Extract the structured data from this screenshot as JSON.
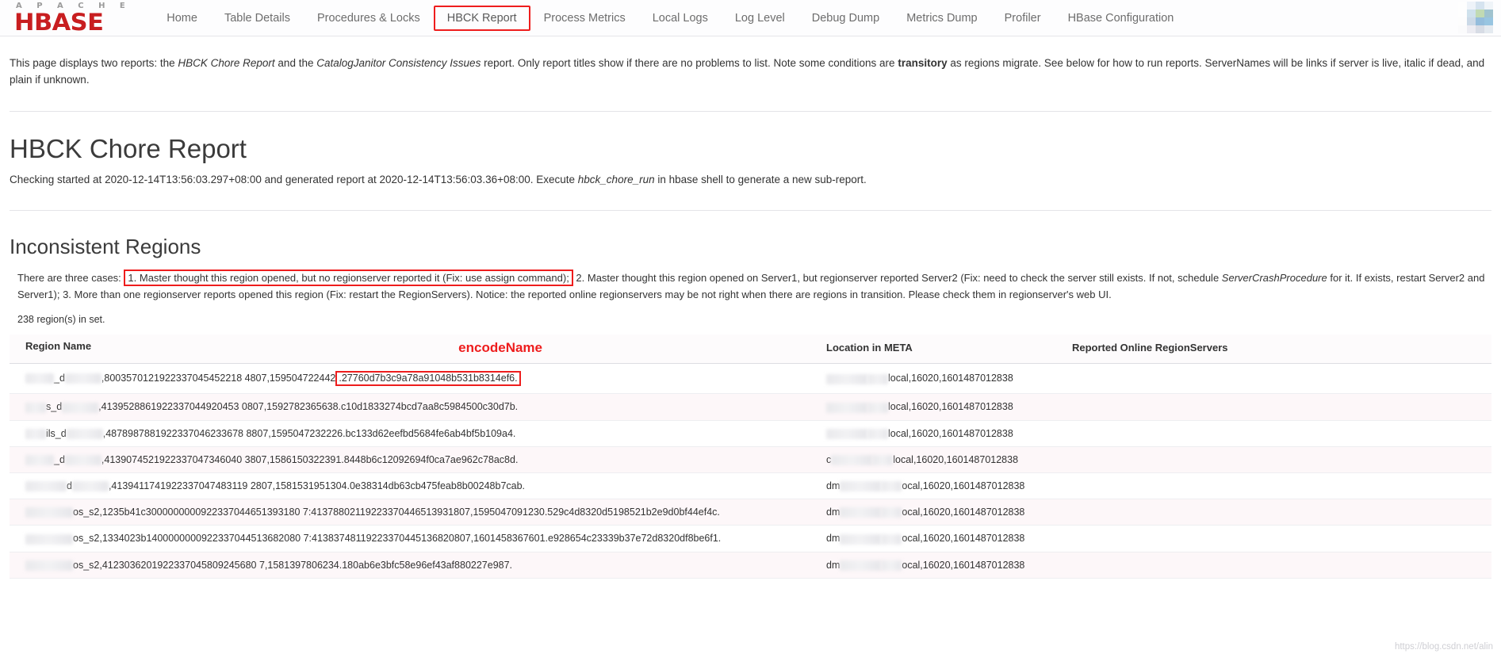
{
  "nav": {
    "brand_top": "A P A C H E",
    "brand_main": "HBASE",
    "items": [
      {
        "label": "Home",
        "name": "nav-home",
        "highlighted": false
      },
      {
        "label": "Table Details",
        "name": "nav-table-details",
        "highlighted": false
      },
      {
        "label": "Procedures & Locks",
        "name": "nav-procedures-locks",
        "highlighted": false
      },
      {
        "label": "HBCK Report",
        "name": "nav-hbck-report",
        "highlighted": true
      },
      {
        "label": "Process Metrics",
        "name": "nav-process-metrics",
        "highlighted": false
      },
      {
        "label": "Local Logs",
        "name": "nav-local-logs",
        "highlighted": false
      },
      {
        "label": "Log Level",
        "name": "nav-log-level",
        "highlighted": false
      },
      {
        "label": "Debug Dump",
        "name": "nav-debug-dump",
        "highlighted": false
      },
      {
        "label": "Metrics Dump",
        "name": "nav-metrics-dump",
        "highlighted": false
      },
      {
        "label": "Profiler",
        "name": "nav-profiler",
        "highlighted": false
      },
      {
        "label": "HBase Configuration",
        "name": "nav-hbase-configuration",
        "highlighted": false
      }
    ]
  },
  "intro": {
    "p1": "This page displays two reports: the ",
    "em1": "HBCK Chore Report",
    "p2": " and the ",
    "em2": "CatalogJanitor Consistency Issues",
    "p3": " report. Only report titles show if there are no problems to list. Note some conditions are ",
    "strong1": "transitory",
    "p4": " as regions migrate. See below for how to run reports. ServerNames will be links if server is live, italic if dead, and plain if unknown."
  },
  "report": {
    "title": "HBCK Chore Report",
    "sub_p1": "Checking started at 2020-12-14T13:56:03.297+08:00 and generated report at 2020-12-14T13:56:03.36+08:00. Execute ",
    "sub_em": "hbck_chore_run",
    "sub_p2": " in hbase shell to generate a new sub-report."
  },
  "inconsistent": {
    "title": "Inconsistent Regions",
    "cases_p1": "There are three cases: ",
    "cases_boxed": "1. Master thought this region opened, but no regionserver reported it (Fix: use assign command);",
    "cases_p2": " 2. Master thought this region opened on Server1, but regionserver reported Server2 (Fix: need to check the server still exists. If not, schedule ",
    "cases_em1": "ServerCrashProcedure",
    "cases_p3": " for it. If exists, restart Server2 and Server1); 3. More than one regionserver reports opened this region (Fix: restart the RegionServers). Notice: the reported online regionservers may be not right when there are regions in transition. Please check them in regionserver's web UI.",
    "count": "238 region(s) in set."
  },
  "table": {
    "headers": {
      "region_name": "Region Name",
      "encode_name": "encodeName",
      "location_meta": "Location in META",
      "reported_rs": "Reported Online RegionServers"
    },
    "rows": [
      {
        "prefix_redacted": true,
        "mid_text": "_d",
        "region_main": ",800357012192233704545221848 07,1595047224421",
        "region_text": ",8003570121922337045452218 4807,159504722442",
        "region_plain": ",8003570121922337045452218 4807,159504722442",
        "region_value": ",8003570121922337045452218 4807,159504722442",
        "encode_boxed": ".27760d7b3c9a78a91048b531b8314ef6.",
        "meta_suffix": "local,16020,1601487012838",
        "meta_prefix": "",
        "reported": ""
      },
      {
        "mid_text": "s_d",
        "region_value": ",4139528861922337044920453 0807,1592782365638.c10d1833274bcd7aa8c5984500c30d7b.",
        "encode_boxed": "",
        "meta_suffix": "local,16020,1601487012838",
        "meta_prefix": "",
        "reported": ""
      },
      {
        "mid_text": "ils_d",
        "region_value": ",4878987881922337046233678 8807,1595047232226.bc133d62eefbd5684fe6ab4bf5b109a4.",
        "encode_boxed": "",
        "meta_suffix": "local,16020,1601487012838",
        "meta_prefix": "",
        "reported": ""
      },
      {
        "mid_text": "_d",
        "region_value": ",4139074521922337047346040 3807,1586150322391.8448b6c12092694f0ca7ae962c78ac8d.",
        "encode_boxed": "",
        "meta_suffix": "local,16020,1601487012838",
        "meta_prefix": "c",
        "reported": ""
      },
      {
        "mid_text": "d",
        "region_value": ",4139411741922337047483119 2807,1581531951304.0e38314db63cb475feab8b00248b7cab.",
        "encode_boxed": "",
        "meta_suffix": "ocal,16020,1601487012838",
        "meta_prefix": "dm",
        "reported": ""
      },
      {
        "mid_text": "os_s2",
        "region_value": ",1235b41c3000000000922337044651393180 7:41378802119223370446513931807,1595047091230.529c4d8320d5198521b2e9d0bf44ef4c.",
        "encode_boxed": "",
        "meta_suffix": "ocal,16020,1601487012838",
        "meta_prefix": "dm",
        "reported": ""
      },
      {
        "mid_text": "os_s2",
        "region_value": ",1334023b1400000000922337044513682080 7:41383748119223370445136820807,1601458367601.e928654c23339b37e72d8320df8be6f1.",
        "encode_boxed": "",
        "meta_suffix": "ocal,16020,1601487012838",
        "meta_prefix": "dm",
        "reported": ""
      },
      {
        "mid_text": "os_s2",
        "region_value": ",4123036201922337045809245680 7,1581397806234.180ab6e3bfc58e96ef43af880227e987.",
        "encode_boxed": "",
        "meta_suffix": "ocal,16020,1601487012838",
        "meta_prefix": "dm",
        "reported": ""
      }
    ]
  },
  "watermark": "https://blog.csdn.net/alin",
  "colors": {
    "brand_red": "#c81e20",
    "highlight_red": "#ee1d1d",
    "text": "#333333",
    "nav_text": "#6d6d6d"
  }
}
